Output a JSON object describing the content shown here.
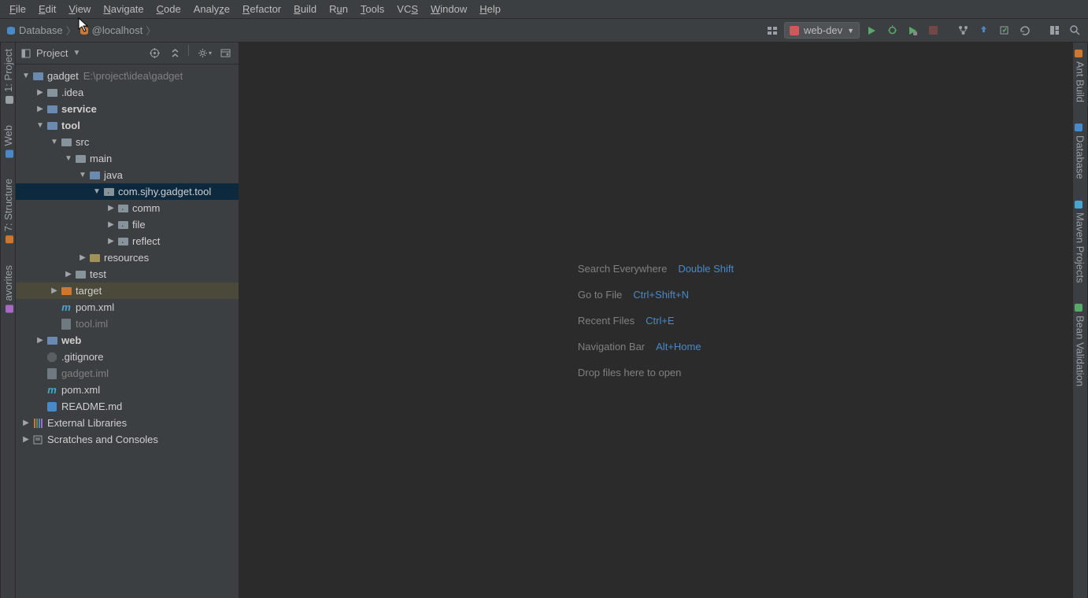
{
  "menubar": [
    {
      "label": "File",
      "u": "F"
    },
    {
      "label": "Edit",
      "u": "E"
    },
    {
      "label": "View",
      "u": "V"
    },
    {
      "label": "Navigate",
      "u": "N"
    },
    {
      "label": "Code",
      "u": "C"
    },
    {
      "label": "Analyze",
      "u": "z"
    },
    {
      "label": "Refactor",
      "u": "R"
    },
    {
      "label": "Build",
      "u": "B"
    },
    {
      "label": "Run",
      "u": "u"
    },
    {
      "label": "Tools",
      "u": "T"
    },
    {
      "label": "VCS",
      "u": "S"
    },
    {
      "label": "Window",
      "u": "W"
    },
    {
      "label": "Help",
      "u": "H"
    }
  ],
  "breadcrumb": [
    {
      "icon": "database",
      "label": "Database"
    },
    {
      "icon": "datasource",
      "label": "@localhost"
    }
  ],
  "run_config": "web-dev",
  "panel_title": "Project",
  "project_root": {
    "name": "gadget",
    "path": "E:\\project\\idea\\gadget"
  },
  "tree": [
    {
      "depth": 0,
      "arrow": "down",
      "icon": "module",
      "label": "gadget",
      "muted": "E:\\project\\idea\\gadget"
    },
    {
      "depth": 1,
      "arrow": "right",
      "icon": "folder",
      "label": ".idea"
    },
    {
      "depth": 1,
      "arrow": "right",
      "icon": "folder-blue",
      "label": "service",
      "bold": true
    },
    {
      "depth": 1,
      "arrow": "down",
      "icon": "folder-blue",
      "label": "tool",
      "bold": true
    },
    {
      "depth": 2,
      "arrow": "down",
      "icon": "folder",
      "label": "src"
    },
    {
      "depth": 3,
      "arrow": "down",
      "icon": "folder",
      "label": "main"
    },
    {
      "depth": 4,
      "arrow": "down",
      "icon": "folder-blue",
      "label": "java"
    },
    {
      "depth": 5,
      "arrow": "down",
      "icon": "package",
      "label": "com.sjhy.gadget.tool",
      "selected": true
    },
    {
      "depth": 6,
      "arrow": "right",
      "icon": "package",
      "label": "comm"
    },
    {
      "depth": 6,
      "arrow": "right",
      "icon": "package",
      "label": "file"
    },
    {
      "depth": 6,
      "arrow": "right",
      "icon": "package",
      "label": "reflect"
    },
    {
      "depth": 4,
      "arrow": "right",
      "icon": "resources",
      "label": "resources"
    },
    {
      "depth": 3,
      "arrow": "right",
      "icon": "folder",
      "label": "test"
    },
    {
      "depth": 2,
      "arrow": "right",
      "icon": "folder-orange",
      "label": "target",
      "highlighted": true
    },
    {
      "depth": 2,
      "arrow": "none",
      "icon": "maven",
      "label": "pom.xml"
    },
    {
      "depth": 2,
      "arrow": "none",
      "icon": "file",
      "label": "tool.iml",
      "dim": true
    },
    {
      "depth": 1,
      "arrow": "right",
      "icon": "folder-blue",
      "label": "web",
      "bold": true
    },
    {
      "depth": 1,
      "arrow": "none",
      "icon": "gitignore",
      "label": ".gitignore"
    },
    {
      "depth": 1,
      "arrow": "none",
      "icon": "file",
      "label": "gadget.iml",
      "dim": true
    },
    {
      "depth": 1,
      "arrow": "none",
      "icon": "maven",
      "label": "pom.xml"
    },
    {
      "depth": 1,
      "arrow": "none",
      "icon": "markdown",
      "label": "README.md"
    },
    {
      "depth": 0,
      "arrow": "right",
      "icon": "libraries",
      "label": "External Libraries"
    },
    {
      "depth": 0,
      "arrow": "right",
      "icon": "scratches",
      "label": "Scratches and Consoles"
    }
  ],
  "hints": [
    {
      "label": "Search Everywhere",
      "key": "Double Shift"
    },
    {
      "label": "Go to File",
      "key": "Ctrl+Shift+N"
    },
    {
      "label": "Recent Files",
      "key": "Ctrl+E"
    },
    {
      "label": "Navigation Bar",
      "key": "Alt+Home"
    },
    {
      "label": "Drop files here to open",
      "key": ""
    }
  ],
  "left_gutter": [
    {
      "label": "1: Project",
      "icon": "project"
    },
    {
      "label": "Web",
      "icon": "web"
    },
    {
      "label": "7: Structure",
      "icon": "structure"
    },
    {
      "label": "avorites",
      "icon": "favorites"
    }
  ],
  "right_gutter": [
    {
      "label": "Ant Build",
      "icon": "ant"
    },
    {
      "label": "Database",
      "icon": "database"
    },
    {
      "label": "Maven Projects",
      "icon": "maven"
    },
    {
      "label": "Bean Validation",
      "icon": "bean"
    }
  ]
}
